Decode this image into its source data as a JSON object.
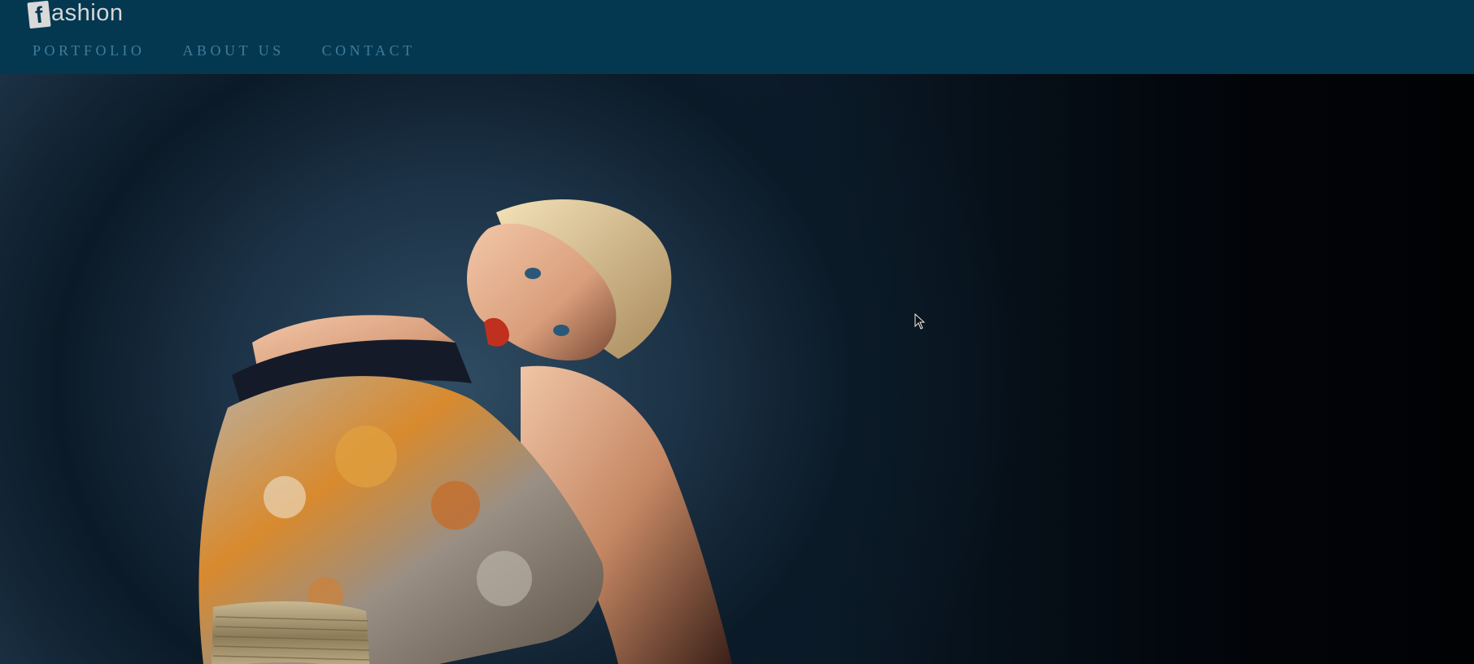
{
  "logo": {
    "mark": "f",
    "text": "ashion"
  },
  "nav": {
    "items": [
      {
        "label": "PORTFOLIO"
      },
      {
        "label": "ABOUT US"
      },
      {
        "label": "CONTACT"
      }
    ]
  },
  "colors": {
    "header_bg": "#043850",
    "nav_text": "#3f7c9c",
    "logo_text": "#d6d6d6"
  }
}
